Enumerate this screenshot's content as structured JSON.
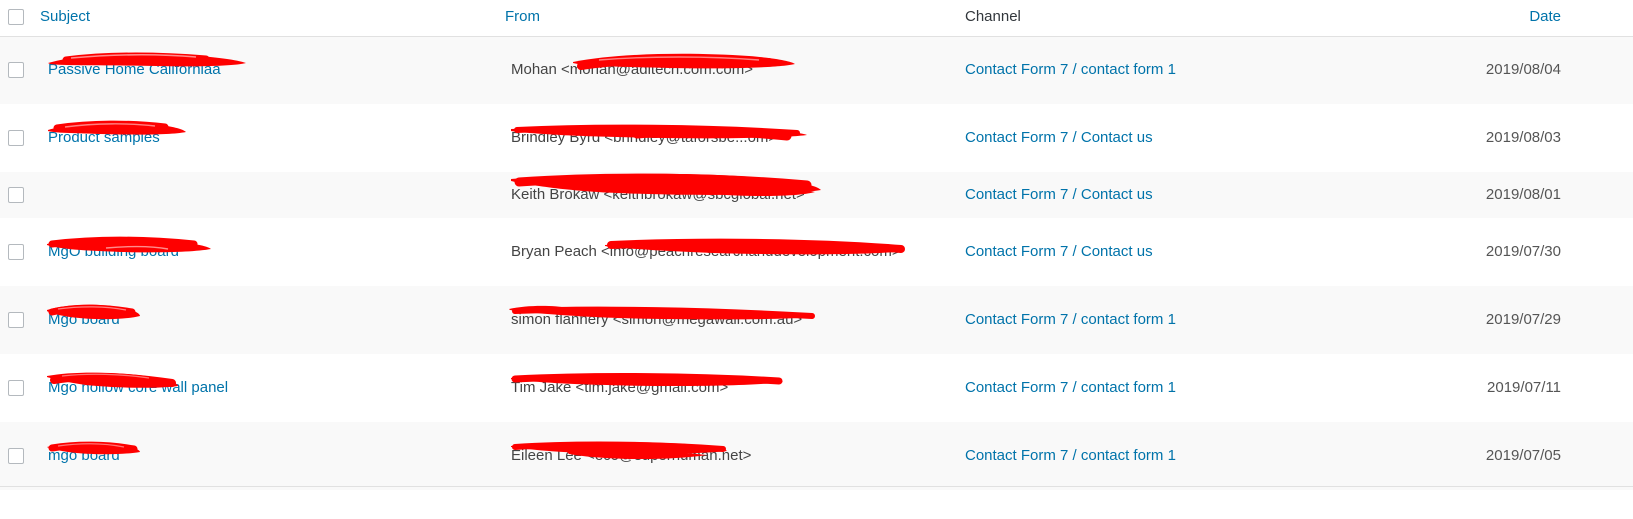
{
  "table": {
    "columns": [
      {
        "key": "checkbox",
        "label": "",
        "type": "select-all"
      },
      {
        "key": "subject",
        "label": "Subject",
        "link": true
      },
      {
        "key": "from",
        "label": "From",
        "link": true
      },
      {
        "key": "channel",
        "label": "Channel",
        "link": false
      },
      {
        "key": "date",
        "label": "Date",
        "link": true
      }
    ],
    "rows": [
      {
        "subject": "Passive Home Californiaa",
        "from": "Mohan <mohan@adltech.com.com>",
        "channel": "Contact Form 7 / contact form 1",
        "date": "2019/08/04",
        "checked": false
      },
      {
        "subject": "Product samples",
        "from": "Brindley Byrd <brindley@taforsbe...om>",
        "channel": "Contact Form 7 / Contact us",
        "date": "2019/08/03",
        "checked": false
      },
      {
        "subject": "",
        "from": "Keith Brokaw <keithbrokaw@sbcglobal.net>",
        "channel": "Contact Form 7 / Contact us",
        "date": "2019/08/01",
        "checked": false
      },
      {
        "subject": "MgO building board",
        "from": "Bryan Peach <info@peachresearchanddevelopment.com>",
        "channel": "Contact Form 7 / Contact us",
        "date": "2019/07/30",
        "checked": false
      },
      {
        "subject": "Mgo board",
        "from": "simon flannery <simon@megawall.com.au>",
        "channel": "Contact Form 7 / contact form 1",
        "date": "2019/07/29",
        "checked": false
      },
      {
        "subject": "Mgo hollow core wall panel",
        "from": "Tim  Jake <tim.jake@gmail.com>",
        "channel": "Contact Form 7 / contact form 1",
        "date": "2019/07/11",
        "checked": false
      },
      {
        "subject": "mgo board",
        "from": "Eileen Lee <eco@superhuman.net>",
        "channel": "Contact Form 7 / contact form 1",
        "date": "2019/07/05",
        "checked": false
      }
    ]
  },
  "colors": {
    "link": "#0073aa",
    "text": "#32373c",
    "row_alt": "#f9f9f9",
    "row_base": "#ffffff",
    "rule": "#e1e1e1",
    "redaction": "#fe0000"
  },
  "icons": {
    "checkbox": "checkbox-icon"
  }
}
